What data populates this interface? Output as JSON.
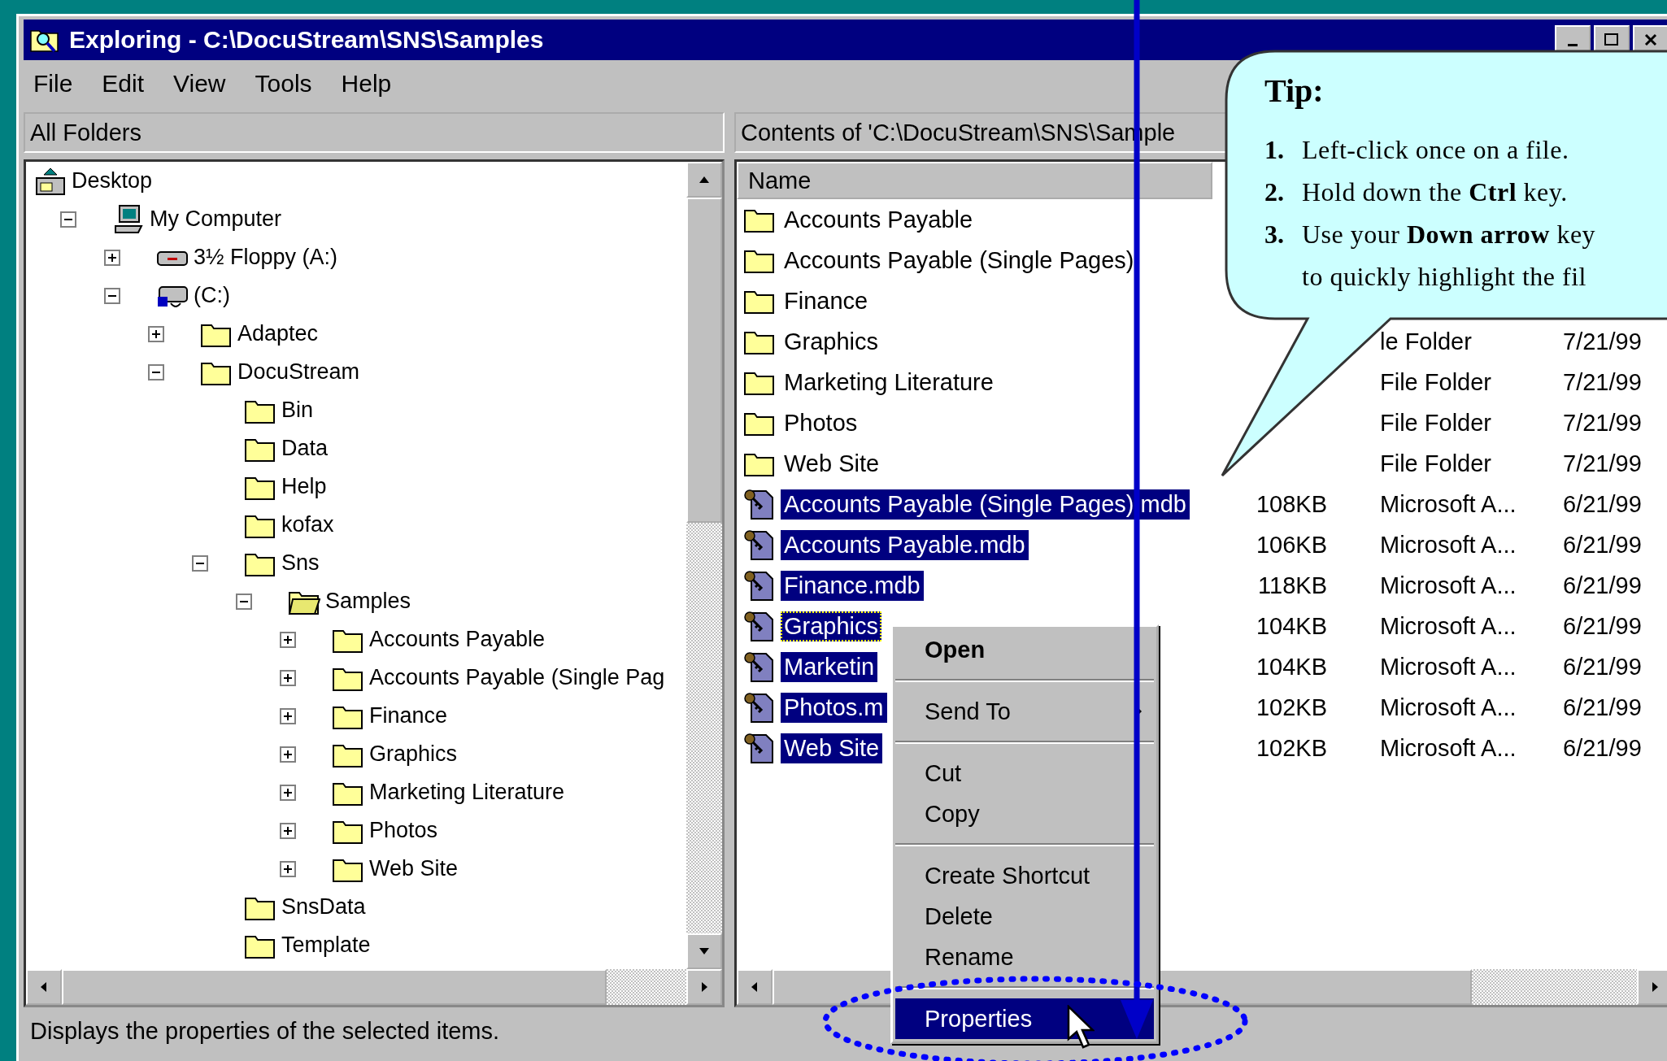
{
  "window": {
    "title": "Exploring - C:\\DocuStream\\SNS\\Samples"
  },
  "menu": [
    "File",
    "Edit",
    "View",
    "Tools",
    "Help"
  ],
  "tree": {
    "header": "All Folders",
    "items": [
      {
        "label": "Desktop",
        "kind": "desktop",
        "children": [
          {
            "label": "My Computer",
            "kind": "computer",
            "expanded": true,
            "children": [
              {
                "label": "3½ Floppy (A:)",
                "kind": "floppy",
                "expanded": false
              },
              {
                "label": "(C:)",
                "kind": "drive",
                "expanded": true,
                "children": [
                  {
                    "label": "Adaptec",
                    "kind": "folder",
                    "expanded": false
                  },
                  {
                    "label": "DocuStream",
                    "kind": "folder",
                    "expanded": true,
                    "children": [
                      {
                        "label": "Bin",
                        "kind": "folder"
                      },
                      {
                        "label": "Data",
                        "kind": "folder"
                      },
                      {
                        "label": "Help",
                        "kind": "folder"
                      },
                      {
                        "label": "kofax",
                        "kind": "folder"
                      },
                      {
                        "label": "Sns",
                        "kind": "folder",
                        "expanded": true,
                        "children": [
                          {
                            "label": "Samples",
                            "kind": "open-folder",
                            "expanded": true,
                            "children": [
                              {
                                "label": "Accounts Payable",
                                "kind": "folder",
                                "expanded": false
                              },
                              {
                                "label": "Accounts Payable (Single Pag",
                                "kind": "folder",
                                "expanded": false
                              },
                              {
                                "label": "Finance",
                                "kind": "folder",
                                "expanded": false
                              },
                              {
                                "label": "Graphics",
                                "kind": "folder",
                                "expanded": false
                              },
                              {
                                "label": "Marketing Literature",
                                "kind": "folder",
                                "expanded": false
                              },
                              {
                                "label": "Photos",
                                "kind": "folder",
                                "expanded": false
                              },
                              {
                                "label": "Web Site",
                                "kind": "folder",
                                "expanded": false
                              }
                            ]
                          }
                        ]
                      },
                      {
                        "label": "SnsData",
                        "kind": "folder"
                      },
                      {
                        "label": "Template",
                        "kind": "folder"
                      }
                    ]
                  }
                ]
              }
            ]
          }
        ]
      }
    ]
  },
  "list": {
    "header": "Contents of 'C:\\DocuStream\\SNS\\Sample",
    "columns": [
      "Name"
    ],
    "rows": [
      {
        "kind": "folder",
        "name": "Accounts Payable",
        "selected": false,
        "focused": false
      },
      {
        "kind": "folder",
        "name": "Accounts Payable (Single Pages)",
        "selected": false,
        "focused": false
      },
      {
        "kind": "folder",
        "name": "Finance",
        "selected": false,
        "focused": false
      },
      {
        "kind": "folder",
        "name": "Graphics",
        "type": "le Folder",
        "modified": "7/21/99",
        "selected": false,
        "focused": false
      },
      {
        "kind": "folder",
        "name": "Marketing Literature",
        "type": "File Folder",
        "modified": "7/21/99",
        "selected": false,
        "focused": false
      },
      {
        "kind": "folder",
        "name": "Photos",
        "type": "File Folder",
        "modified": "7/21/99",
        "selected": false,
        "focused": false
      },
      {
        "kind": "folder",
        "name": "Web Site",
        "type": "File Folder",
        "modified": "7/21/99",
        "selected": false,
        "focused": false
      },
      {
        "kind": "database",
        "name": "Accounts Payable (Single Pages).mdb",
        "size": "108KB",
        "type": "Microsoft A...",
        "modified": "6/21/99",
        "selected": true,
        "focused": false
      },
      {
        "kind": "database",
        "name": "Accounts Payable.mdb",
        "size": "106KB",
        "type": "Microsoft A...",
        "modified": "6/21/99",
        "selected": true,
        "focused": false
      },
      {
        "kind": "database",
        "name": "Finance.mdb",
        "size": "118KB",
        "type": "Microsoft A...",
        "modified": "6/21/99",
        "selected": true,
        "focused": false
      },
      {
        "kind": "database",
        "name": "Graphics",
        "size": "104KB",
        "type": "Microsoft A...",
        "modified": "6/21/99",
        "selected": true,
        "focused": true
      },
      {
        "kind": "database",
        "name": "Marketin",
        "size": "104KB",
        "type": "Microsoft A...",
        "modified": "6/21/99",
        "selected": true,
        "focused": false
      },
      {
        "kind": "database",
        "name": "Photos.m",
        "size": "102KB",
        "type": "Microsoft A...",
        "modified": "6/21/99",
        "selected": true,
        "focused": false
      },
      {
        "kind": "database",
        "name": "Web Site",
        "size": "102KB",
        "type": "Microsoft A...",
        "modified": "6/21/99",
        "selected": true,
        "focused": false
      }
    ]
  },
  "context_menu": [
    {
      "kind": "item",
      "label": "Open",
      "default": true,
      "selected": false
    },
    {
      "kind": "separator"
    },
    {
      "kind": "submenu",
      "label": "Send To",
      "default": false,
      "selected": false
    },
    {
      "kind": "separator"
    },
    {
      "kind": "item",
      "label": "Cut",
      "default": false,
      "selected": false
    },
    {
      "kind": "item",
      "label": "Copy",
      "default": false,
      "selected": false
    },
    {
      "kind": "separator"
    },
    {
      "kind": "item",
      "label": "Create Shortcut",
      "default": false,
      "selected": false
    },
    {
      "kind": "item",
      "label": "Delete",
      "default": false,
      "selected": false
    },
    {
      "kind": "item",
      "label": "Rename",
      "default": false,
      "selected": false
    },
    {
      "kind": "separator"
    },
    {
      "kind": "item",
      "label": "Properties",
      "default": false,
      "selected": true
    }
  ],
  "tip": {
    "title": "Tip:",
    "steps": [
      {
        "number": "1.",
        "lines": [
          "Left-click once on a file."
        ]
      },
      {
        "number": "2.",
        "lines": [
          "Hold down the **Ctrl** key."
        ]
      },
      {
        "number": "3.",
        "lines": [
          "Use your **Down arrow** key",
          "to quickly highlight the fil"
        ]
      }
    ]
  },
  "status_bar": "Displays the properties of the selected items."
}
